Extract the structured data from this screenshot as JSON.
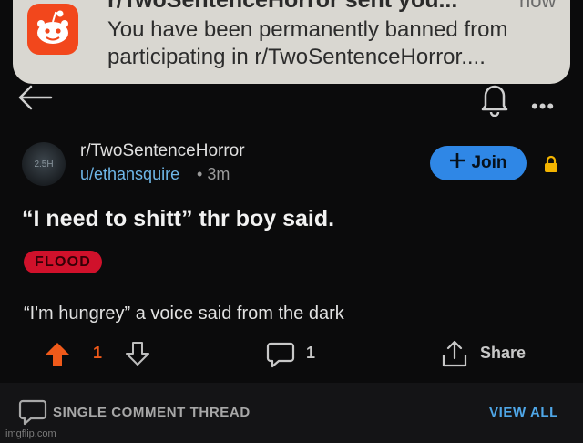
{
  "notification": {
    "title": "r/TwoSentenceHorror sent you...",
    "time": "now",
    "body": "You have been permanently banned from participating in r/TwoSentenceHorror....",
    "app_icon": "reddit-logo-icon"
  },
  "post": {
    "subreddit": "r/TwoSentenceHorror",
    "avatar_text": "2.5H",
    "author": "u/ethansquire",
    "separator": "•",
    "age": "3m",
    "join_label": "Join",
    "title": "“I need to shitt” thr boy said.",
    "flair": "FLOOD",
    "body": "“I'm hungrey” a voice said from the dark",
    "vote_count": "1",
    "comment_count": "1",
    "share_label": "Share"
  },
  "bottom_bar": {
    "thread_label": "SINGLE COMMENT THREAD",
    "view_all_label": "VIEW ALL"
  },
  "watermark": "imgflip.com",
  "colors": {
    "background": "#0b0b0c",
    "join": "#2f87e6",
    "flair": "#d0112b",
    "upvote": "#f05a1a",
    "link": "#4fa7e8",
    "lock": "#f4b400"
  }
}
